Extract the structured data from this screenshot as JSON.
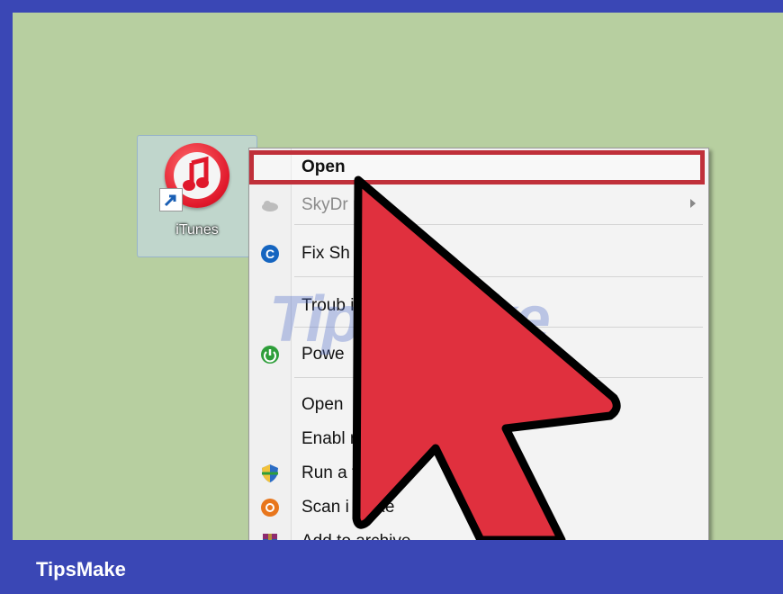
{
  "desktop": {
    "shortcut_label": "iTunes"
  },
  "context_menu": {
    "items": [
      {
        "label": "Open",
        "bold": true,
        "icon": "none"
      },
      {
        "label": "SkyDr    ro",
        "disabled": true,
        "icon": "cloud-icon",
        "has_submenu": true
      },
      {
        "label": "Fix Sh",
        "icon": "ccleaner-icon"
      },
      {
        "label": "Troub                                 ility",
        "icon": "none"
      },
      {
        "label": "Powe",
        "icon": "power-icon"
      },
      {
        "label": "Open",
        "icon": "none"
      },
      {
        "label": "Enabl                              nature Icons",
        "icon": "none"
      },
      {
        "label": "Run a            tra",
        "icon": "shield-icon"
      },
      {
        "label": "Scan i         s.exe",
        "icon": "antivirus-icon"
      },
      {
        "label": "Add to archive...",
        "icon": "archive-icon"
      }
    ]
  },
  "watermark": "TipsMake",
  "footer": {
    "brand": "TipsMake"
  },
  "colors": {
    "frame": "#3a47b5",
    "desktop": "#b7cfa0",
    "highlight": "#c0303a",
    "arrow_fill": "#e0303e"
  }
}
